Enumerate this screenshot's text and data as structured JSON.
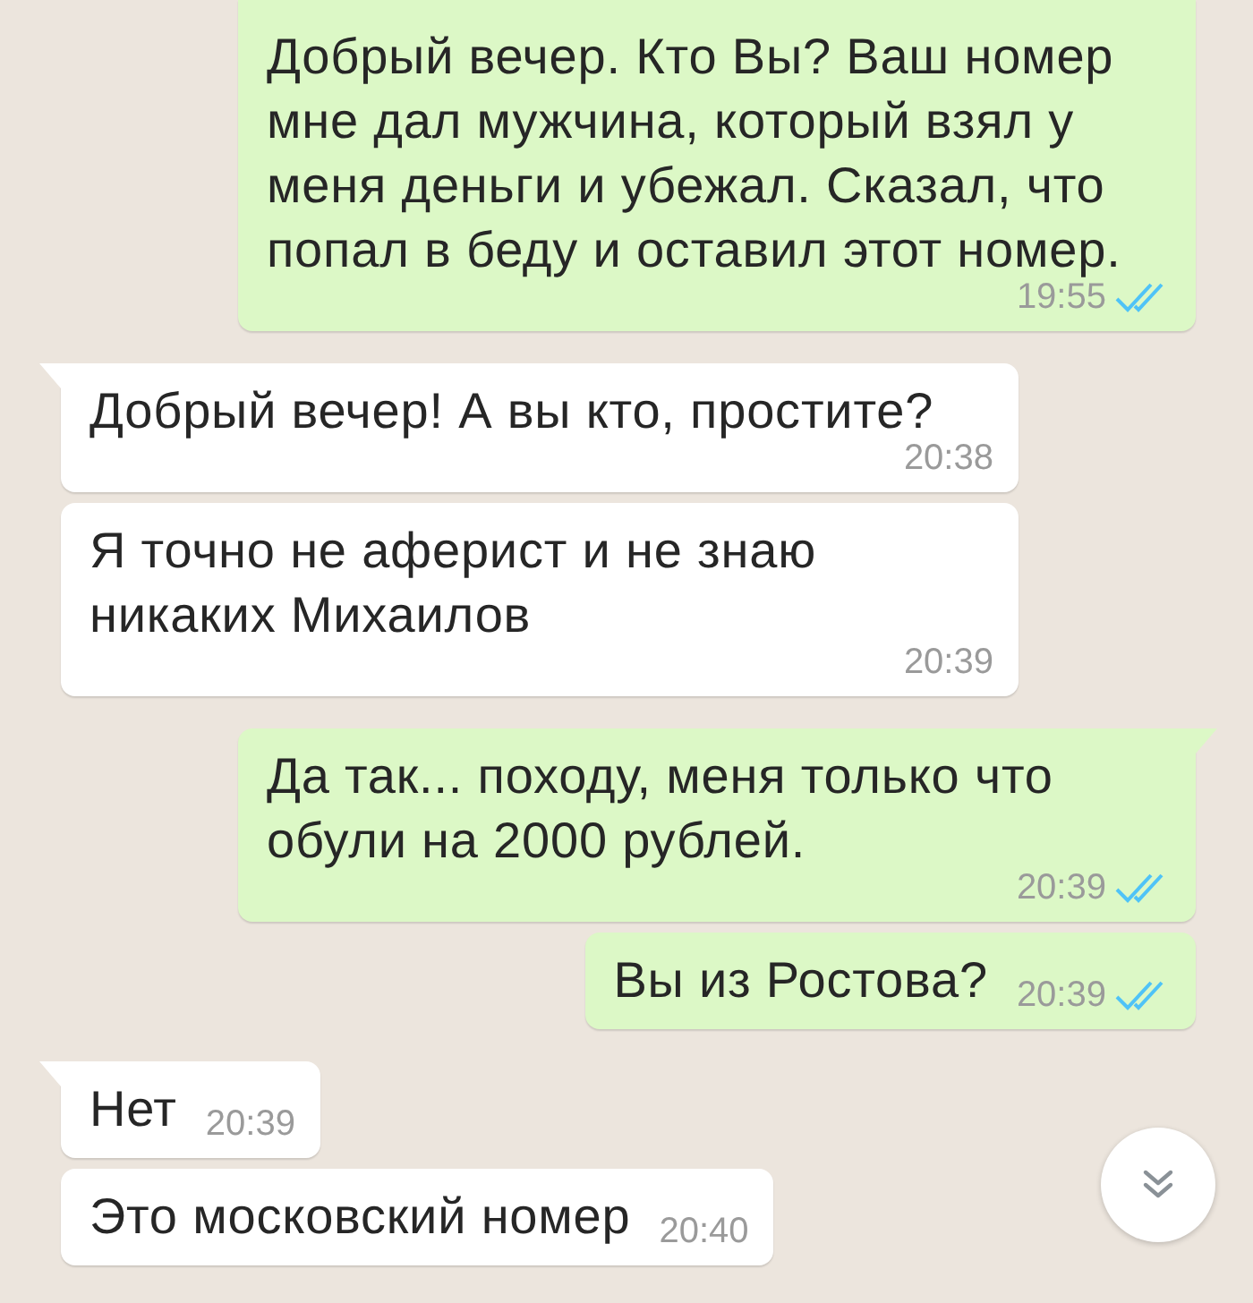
{
  "messages": [
    {
      "kind": "out",
      "text": "Добрый вечер. Кто Вы? Ваш номер мне дал мужчина, который взял у меня деньги и убежал. Сказал, что попал в беду и оставил этот номер.",
      "time": "19:55",
      "read": true,
      "tail": false
    },
    {
      "kind": "in",
      "text": "Добрый вечер! А вы кто, простите?",
      "time": "20:38",
      "tail": true
    },
    {
      "kind": "in",
      "text": "Я точно не аферист и не знаю никаких Михаилов",
      "time": "20:39",
      "tail": false
    },
    {
      "kind": "out",
      "text": "Да так... походу, меня только что обули на 2000 рублей.",
      "time": "20:39",
      "read": true,
      "tail": true
    },
    {
      "kind": "out",
      "text": "Вы из Ростова?",
      "time": "20:39",
      "read": true,
      "tail": false
    },
    {
      "kind": "in",
      "text": "Нет",
      "time": "20:39",
      "tail": true
    },
    {
      "kind": "in",
      "text": "Это московский номер",
      "time": "20:40",
      "tail": false
    }
  ]
}
